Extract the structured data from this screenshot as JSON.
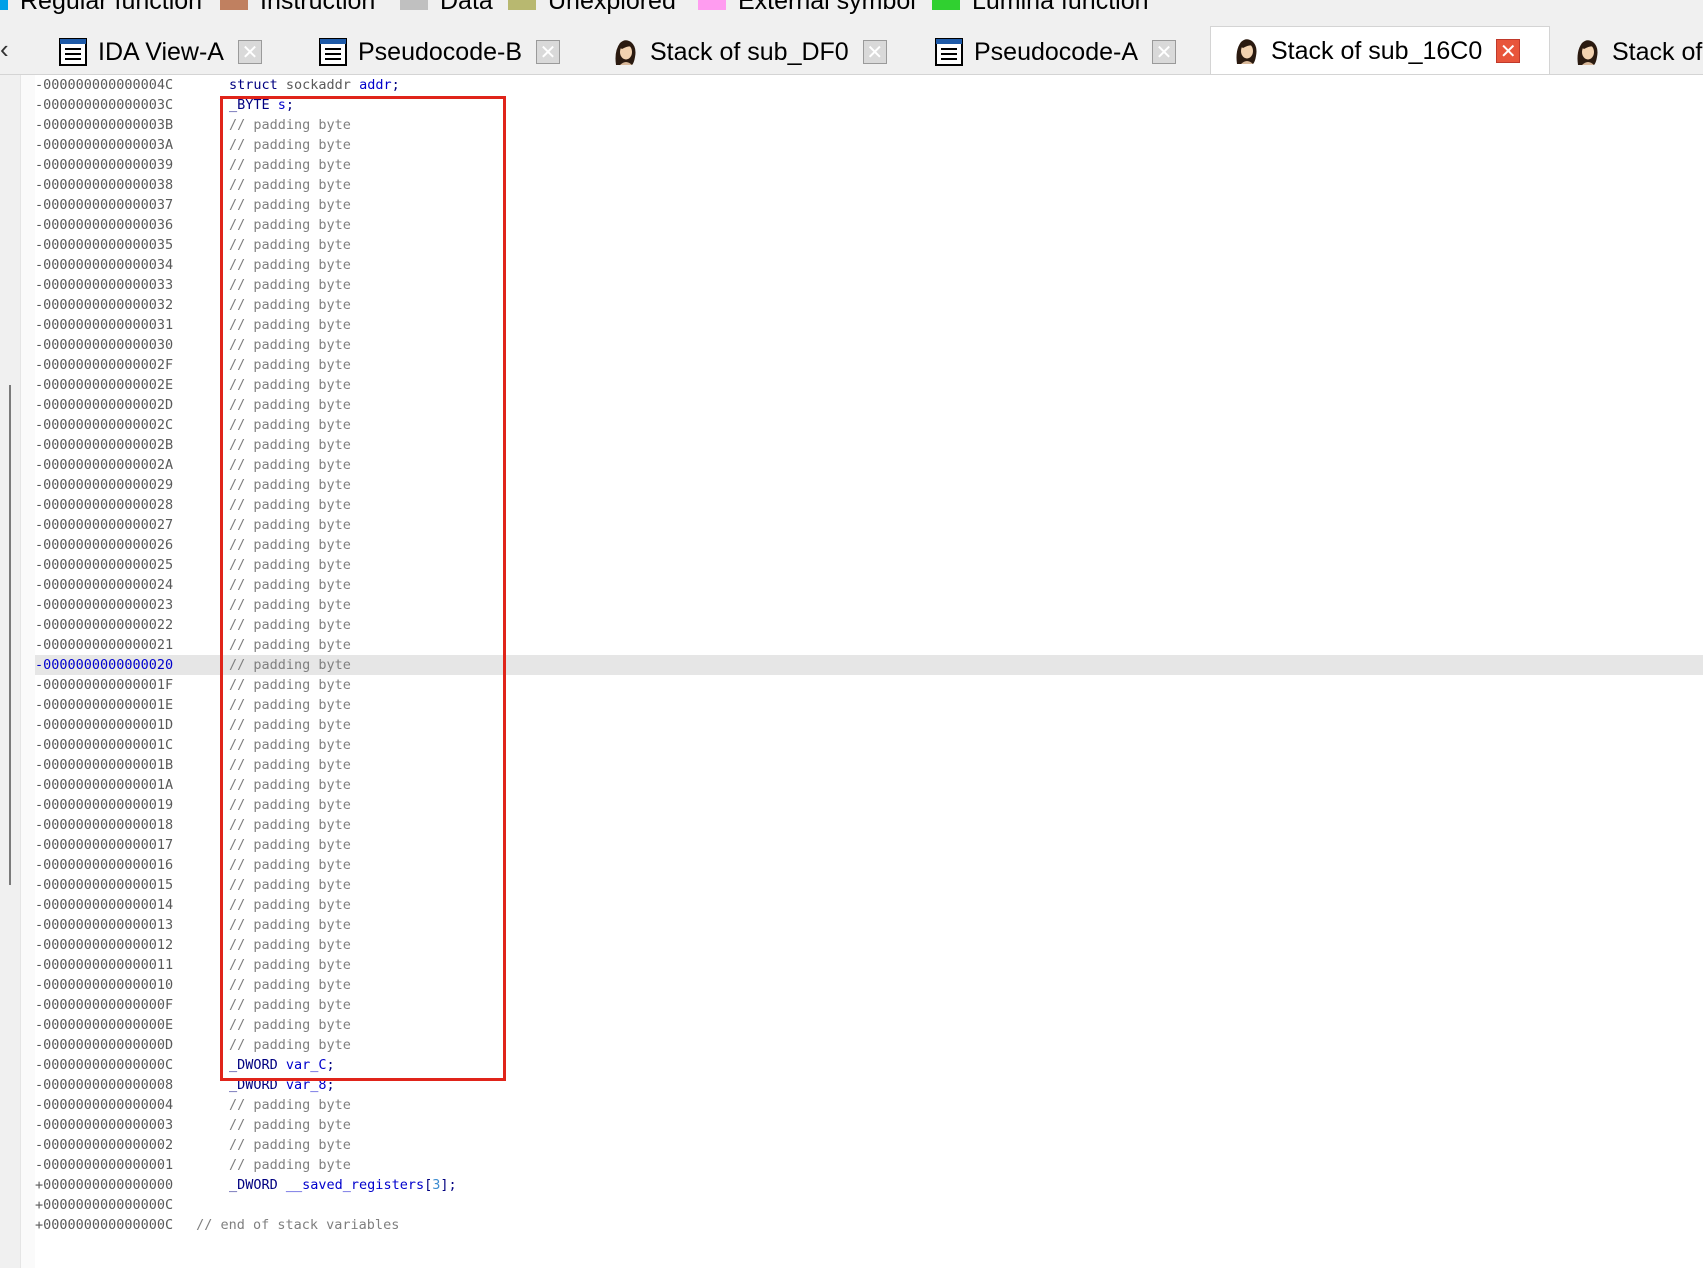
{
  "legend": [
    {
      "label": "Regular function",
      "color": "#00a0e8"
    },
    {
      "label": "Instruction",
      "color": "#c08060"
    },
    {
      "label": "Data",
      "color": "#c0c0c0"
    },
    {
      "label": "Unexplored",
      "color": "#b8b870"
    },
    {
      "label": "External symbol",
      "color": "#ff9cf0"
    },
    {
      "label": "Lumina function",
      "color": "#30d030"
    }
  ],
  "tabs": [
    {
      "label": "IDA View-A",
      "icon": "list-view-icon",
      "active": false
    },
    {
      "label": "Pseudocode-B",
      "icon": "list-view-icon",
      "active": false
    },
    {
      "label": "Stack of sub_DF0",
      "icon": "portrait-icon",
      "active": false
    },
    {
      "label": "Pseudocode-A",
      "icon": "list-view-icon",
      "active": false
    },
    {
      "label": "Stack of sub_16C0",
      "icon": "portrait-icon",
      "active": true
    },
    {
      "label": "Stack of",
      "icon": "portrait-icon",
      "active": false
    }
  ],
  "nav_arrow": "‹",
  "close_glyph": "✕",
  "lines": [
    {
      "offset": "-000000000000004C",
      "parts": [
        [
          "kw",
          "struct "
        ],
        [
          "type",
          "sockaddr "
        ],
        [
          "name",
          "addr"
        ],
        [
          "plain",
          ";"
        ]
      ]
    },
    {
      "offset": "-000000000000003C",
      "parts": [
        [
          "kw",
          "_BYTE "
        ],
        [
          "name",
          "s"
        ],
        [
          "plain",
          ";"
        ]
      ]
    },
    {
      "offset": "-000000000000003B",
      "parts": [
        [
          "cmt",
          "// padding byte"
        ]
      ]
    },
    {
      "offset": "-000000000000003A",
      "parts": [
        [
          "cmt",
          "// padding byte"
        ]
      ]
    },
    {
      "offset": "-0000000000000039",
      "parts": [
        [
          "cmt",
          "// padding byte"
        ]
      ]
    },
    {
      "offset": "-0000000000000038",
      "parts": [
        [
          "cmt",
          "// padding byte"
        ]
      ]
    },
    {
      "offset": "-0000000000000037",
      "parts": [
        [
          "cmt",
          "// padding byte"
        ]
      ]
    },
    {
      "offset": "-0000000000000036",
      "parts": [
        [
          "cmt",
          "// padding byte"
        ]
      ]
    },
    {
      "offset": "-0000000000000035",
      "parts": [
        [
          "cmt",
          "// padding byte"
        ]
      ]
    },
    {
      "offset": "-0000000000000034",
      "parts": [
        [
          "cmt",
          "// padding byte"
        ]
      ]
    },
    {
      "offset": "-0000000000000033",
      "parts": [
        [
          "cmt",
          "// padding byte"
        ]
      ]
    },
    {
      "offset": "-0000000000000032",
      "parts": [
        [
          "cmt",
          "// padding byte"
        ]
      ]
    },
    {
      "offset": "-0000000000000031",
      "parts": [
        [
          "cmt",
          "// padding byte"
        ]
      ]
    },
    {
      "offset": "-0000000000000030",
      "parts": [
        [
          "cmt",
          "// padding byte"
        ]
      ]
    },
    {
      "offset": "-000000000000002F",
      "parts": [
        [
          "cmt",
          "// padding byte"
        ]
      ]
    },
    {
      "offset": "-000000000000002E",
      "parts": [
        [
          "cmt",
          "// padding byte"
        ]
      ]
    },
    {
      "offset": "-000000000000002D",
      "parts": [
        [
          "cmt",
          "// padding byte"
        ]
      ]
    },
    {
      "offset": "-000000000000002C",
      "parts": [
        [
          "cmt",
          "// padding byte"
        ]
      ]
    },
    {
      "offset": "-000000000000002B",
      "parts": [
        [
          "cmt",
          "// padding byte"
        ]
      ]
    },
    {
      "offset": "-000000000000002A",
      "parts": [
        [
          "cmt",
          "// padding byte"
        ]
      ]
    },
    {
      "offset": "-0000000000000029",
      "parts": [
        [
          "cmt",
          "// padding byte"
        ]
      ]
    },
    {
      "offset": "-0000000000000028",
      "parts": [
        [
          "cmt",
          "// padding byte"
        ]
      ]
    },
    {
      "offset": "-0000000000000027",
      "parts": [
        [
          "cmt",
          "// padding byte"
        ]
      ]
    },
    {
      "offset": "-0000000000000026",
      "parts": [
        [
          "cmt",
          "// padding byte"
        ]
      ]
    },
    {
      "offset": "-0000000000000025",
      "parts": [
        [
          "cmt",
          "// padding byte"
        ]
      ]
    },
    {
      "offset": "-0000000000000024",
      "parts": [
        [
          "cmt",
          "// padding byte"
        ]
      ]
    },
    {
      "offset": "-0000000000000023",
      "parts": [
        [
          "cmt",
          "// padding byte"
        ]
      ]
    },
    {
      "offset": "-0000000000000022",
      "parts": [
        [
          "cmt",
          "// padding byte"
        ]
      ]
    },
    {
      "offset": "-0000000000000021",
      "parts": [
        [
          "cmt",
          "// padding byte"
        ]
      ]
    },
    {
      "offset": "-0000000000000020",
      "parts": [
        [
          "cmt",
          "// padding byte"
        ]
      ],
      "highlighted": true
    },
    {
      "offset": "-000000000000001F",
      "parts": [
        [
          "cmt",
          "// padding byte"
        ]
      ]
    },
    {
      "offset": "-000000000000001E",
      "parts": [
        [
          "cmt",
          "// padding byte"
        ]
      ]
    },
    {
      "offset": "-000000000000001D",
      "parts": [
        [
          "cmt",
          "// padding byte"
        ]
      ]
    },
    {
      "offset": "-000000000000001C",
      "parts": [
        [
          "cmt",
          "// padding byte"
        ]
      ]
    },
    {
      "offset": "-000000000000001B",
      "parts": [
        [
          "cmt",
          "// padding byte"
        ]
      ]
    },
    {
      "offset": "-000000000000001A",
      "parts": [
        [
          "cmt",
          "// padding byte"
        ]
      ]
    },
    {
      "offset": "-0000000000000019",
      "parts": [
        [
          "cmt",
          "// padding byte"
        ]
      ]
    },
    {
      "offset": "-0000000000000018",
      "parts": [
        [
          "cmt",
          "// padding byte"
        ]
      ]
    },
    {
      "offset": "-0000000000000017",
      "parts": [
        [
          "cmt",
          "// padding byte"
        ]
      ]
    },
    {
      "offset": "-0000000000000016",
      "parts": [
        [
          "cmt",
          "// padding byte"
        ]
      ]
    },
    {
      "offset": "-0000000000000015",
      "parts": [
        [
          "cmt",
          "// padding byte"
        ]
      ]
    },
    {
      "offset": "-0000000000000014",
      "parts": [
        [
          "cmt",
          "// padding byte"
        ]
      ]
    },
    {
      "offset": "-0000000000000013",
      "parts": [
        [
          "cmt",
          "// padding byte"
        ]
      ]
    },
    {
      "offset": "-0000000000000012",
      "parts": [
        [
          "cmt",
          "// padding byte"
        ]
      ]
    },
    {
      "offset": "-0000000000000011",
      "parts": [
        [
          "cmt",
          "// padding byte"
        ]
      ]
    },
    {
      "offset": "-0000000000000010",
      "parts": [
        [
          "cmt",
          "// padding byte"
        ]
      ]
    },
    {
      "offset": "-000000000000000F",
      "parts": [
        [
          "cmt",
          "// padding byte"
        ]
      ]
    },
    {
      "offset": "-000000000000000E",
      "parts": [
        [
          "cmt",
          "// padding byte"
        ]
      ]
    },
    {
      "offset": "-000000000000000D",
      "parts": [
        [
          "cmt",
          "// padding byte"
        ]
      ]
    },
    {
      "offset": "-000000000000000C",
      "parts": [
        [
          "kw",
          "_DWORD "
        ],
        [
          "name",
          "var_C"
        ],
        [
          "plain",
          ";"
        ]
      ]
    },
    {
      "offset": "-0000000000000008",
      "parts": [
        [
          "kw",
          "_DWORD "
        ],
        [
          "name",
          "var_8"
        ],
        [
          "plain",
          ";"
        ]
      ]
    },
    {
      "offset": "-0000000000000004",
      "parts": [
        [
          "cmt",
          "// padding byte"
        ]
      ]
    },
    {
      "offset": "-0000000000000003",
      "parts": [
        [
          "cmt",
          "// padding byte"
        ]
      ]
    },
    {
      "offset": "-0000000000000002",
      "parts": [
        [
          "cmt",
          "// padding byte"
        ]
      ]
    },
    {
      "offset": "-0000000000000001",
      "parts": [
        [
          "cmt",
          "// padding byte"
        ]
      ]
    },
    {
      "offset": "+0000000000000000",
      "parts": [
        [
          "kw",
          "_DWORD "
        ],
        [
          "name",
          "__saved_registers"
        ],
        [
          "plain",
          "["
        ],
        [
          "num",
          "3"
        ],
        [
          "plain",
          "];"
        ]
      ]
    },
    {
      "offset": "+000000000000000C",
      "parts": []
    },
    {
      "offset": "+000000000000000C",
      "parts": [
        [
          "cmt",
          " // end of stack variables"
        ]
      ],
      "inline": true
    }
  ]
}
